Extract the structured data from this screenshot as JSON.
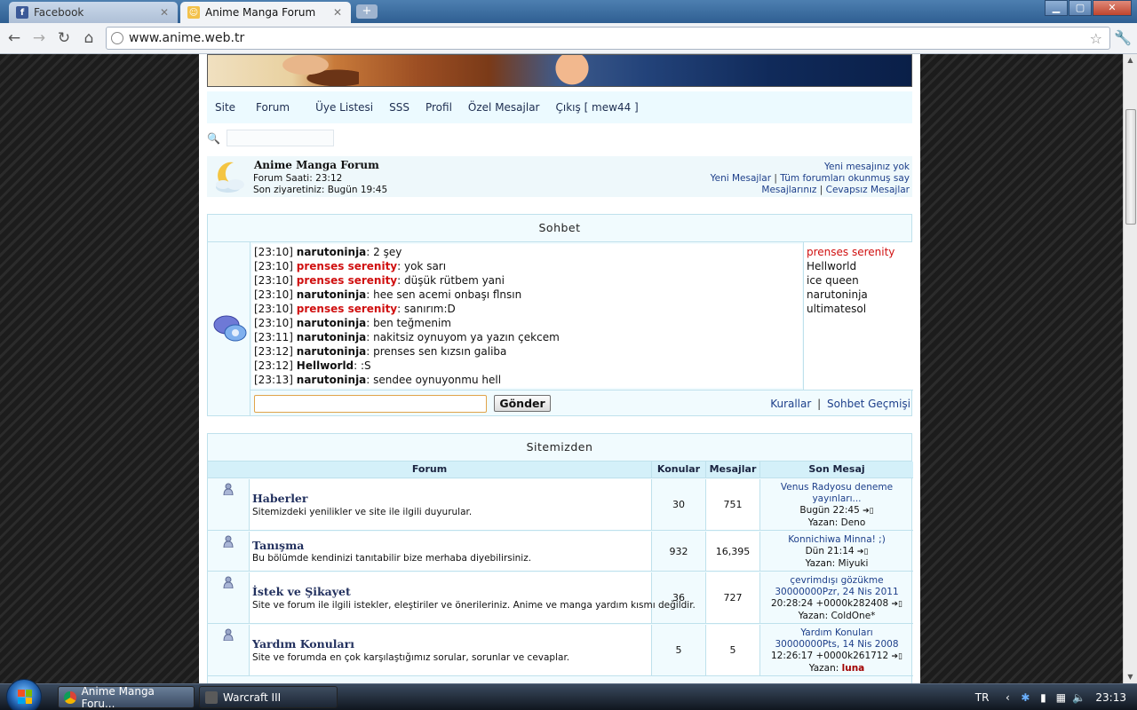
{
  "browser": {
    "tabs": [
      {
        "title": "Facebook",
        "active": false
      },
      {
        "title": "Anime Manga Forum",
        "active": true
      }
    ],
    "new_tab": "+",
    "url": "www.anime.web.tr",
    "window_buttons": {
      "minimize": "▁",
      "maximize": "▢",
      "close": "✕"
    }
  },
  "nav": {
    "items": [
      "Site",
      "Forum",
      "Üye Listesi",
      "SSS",
      "Profil",
      "Özel Mesajlar",
      "Çıkış [ mew44 ]"
    ]
  },
  "header": {
    "site_name": "Anime Manga Forum",
    "forum_time": "Forum Saati: 23:12",
    "last_visit": "Son ziyaretiniz: Bugün 19:45",
    "no_new_messages": "Yeni mesajınız yok",
    "new_messages": "Yeni Mesajlar",
    "mark_all_read": "Tüm forumları okunmuş say",
    "your_messages": "Mesajlarınız",
    "unanswered": "Cevapsız Mesajlar",
    "separator": "|"
  },
  "chat": {
    "title": "Sohbet",
    "messages": [
      {
        "time": "[23:10]",
        "user": "narutoninja",
        "red": false,
        "text": ": 2 şey"
      },
      {
        "time": "[23:10]",
        "user": "prenses serenity",
        "red": true,
        "text": ": yok sarı"
      },
      {
        "time": "[23:10]",
        "user": "prenses serenity",
        "red": true,
        "text": ": düşük rütbem yani"
      },
      {
        "time": "[23:10]",
        "user": "narutoninja",
        "red": false,
        "text": ": hee sen acemi onbaşı flnsın"
      },
      {
        "time": "[23:10]",
        "user": "prenses serenity",
        "red": true,
        "text": ": sanırım:D"
      },
      {
        "time": "[23:10]",
        "user": "narutoninja",
        "red": false,
        "text": ": ben teğmenim"
      },
      {
        "time": "[23:11]",
        "user": "narutoninja",
        "red": false,
        "text": ": nakitsiz oynuyom ya yazın çekcem"
      },
      {
        "time": "[23:12]",
        "user": "narutoninja",
        "red": false,
        "text": ": prenses sen kızsın galiba"
      },
      {
        "time": "[23:12]",
        "user": "Hellworld",
        "red": false,
        "text": ": :S"
      },
      {
        "time": "[23:13]",
        "user": "narutoninja",
        "red": false,
        "text": ": sendee oynuyonmu hell"
      }
    ],
    "online_users": [
      {
        "name": "prenses serenity",
        "red": true
      },
      {
        "name": "Hellworld",
        "red": false
      },
      {
        "name": "ice queen",
        "red": false
      },
      {
        "name": "narutoninja",
        "red": false
      },
      {
        "name": "ultimatesol",
        "red": false
      }
    ],
    "input_value": "",
    "send_label": "Gönder",
    "rules_link": "Kurallar",
    "history_link": "Sohbet Geçmişi",
    "separator": "|"
  },
  "forums": {
    "title": "Sitemizden",
    "columns": {
      "forum": "Forum",
      "topics": "Konular",
      "posts": "Mesajlar",
      "last": "Son Mesaj"
    },
    "rows": [
      {
        "name": "Haberler",
        "description": "Sitemizdeki yenilikler ve site ile ilgili duyurular.",
        "topics": "30",
        "posts": "751",
        "last_lines": [
          "Venus Radyosu deneme",
          "yayınları..."
        ],
        "last_date": "Bugün 22:45",
        "author_label": "Yazan:",
        "author": "Deno",
        "author_bold": false
      },
      {
        "name": "Tanışma",
        "description": "Bu bölümde kendinizi tanıtabilir bize merhaba diyebilirsiniz.",
        "topics": "932",
        "posts": "16,395",
        "last_lines": [
          "Konnichiwa Minna! ;)"
        ],
        "last_date": "Dün 21:14",
        "author_label": "Yazan:",
        "author": "Miyuki",
        "author_bold": false
      },
      {
        "name": "İstek ve Şikayet",
        "description": "Site ve forum ile ilgili istekler, eleştiriler ve önerileriniz. Anime ve manga yardım kısmı değildir.",
        "topics": "36",
        "posts": "727",
        "last_lines": [
          "çevrimdışı gözükme",
          "30000000Pzr, 24 Nis 2011"
        ],
        "last_date": "20:28:24 +0000k282408",
        "author_label": "Yazan:",
        "author": "ColdOne*",
        "author_bold": false
      },
      {
        "name": "Yardım Konuları",
        "description": "Site ve forumda en çok karşılaştığımız sorular, sorunlar ve cevaplar.",
        "topics": "5",
        "posts": "5",
        "last_lines": [
          "Yardım Konuları",
          "30000000Pts, 14 Nis 2008"
        ],
        "last_date": "12:26:17 +0000k261712",
        "author_label": "Yazan:",
        "author": "luna",
        "author_bold": true
      }
    ]
  },
  "taskbar": {
    "tasks": [
      "Anime Manga Foru...",
      "Warcraft III"
    ],
    "language": "TR",
    "clock": "23:13"
  },
  "colors": {
    "accent_red": "#d01010",
    "link_blue": "#1d3f8a",
    "table_border": "#bfe1ec",
    "header_bg": "#d4f0f9"
  }
}
